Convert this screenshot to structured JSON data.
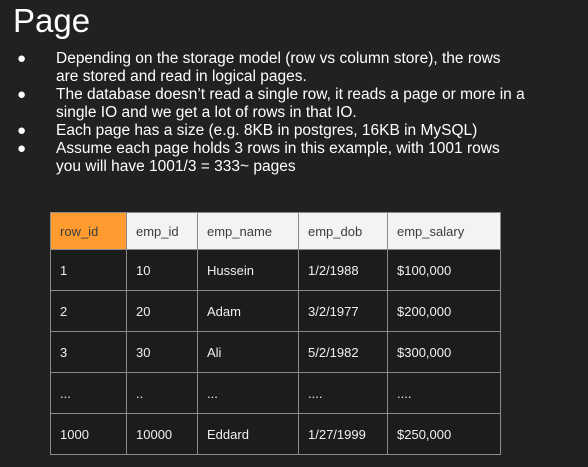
{
  "title": "Page",
  "bullets": [
    "Depending on the storage model (row vs column store), the rows are stored and read in logical pages.",
    "The database doesn’t read a single row, it reads a page or more in a single IO and we get a lot of rows in that IO.",
    "Each page has a size (e.g. 8KB in postgres, 16KB in MySQL)",
    "Assume each page holds 3 rows in this example, with 1001 rows you will have 1001/3 = 333~ pages"
  ],
  "bullet_lines": [
    [
      "Depending on the storage model (row vs column store), the rows",
      "are stored and read in logical pages."
    ],
    [
      "The database doesn’t read a single row, it reads a page or more in a",
      "single IO and we get a lot of rows in that IO."
    ],
    [
      "Each page has a size (e.g. 8KB in postgres, 16KB in MySQL)"
    ],
    [
      "Assume each page holds 3 rows in this example, with 1001 rows",
      "you will have 1001/3 = 333~ pages"
    ]
  ],
  "bullet_glyph": "●",
  "table": {
    "columns": [
      "row_id",
      "emp_id",
      "emp_name",
      "emp_dob",
      "emp_salary"
    ],
    "highlighted_column": "row_id",
    "highlight_color": "#ff9b2f",
    "rows": [
      [
        "1",
        "10",
        "Hussein",
        "1/2/1988",
        "$100,000"
      ],
      [
        "2",
        "20",
        "Adam",
        "3/2/1977",
        "$200,000"
      ],
      [
        "3",
        "30",
        "Ali",
        "5/2/1982",
        "$300,000"
      ],
      [
        "...",
        "..",
        "...",
        "....",
        "...."
      ],
      [
        "1000",
        "10000",
        "Eddard",
        "1/27/1999",
        "$250,000"
      ]
    ]
  },
  "colors": {
    "background": "#212121",
    "text": "#ffffff",
    "header_background": "#f3f3f3",
    "grid": "#8a8a8a"
  }
}
